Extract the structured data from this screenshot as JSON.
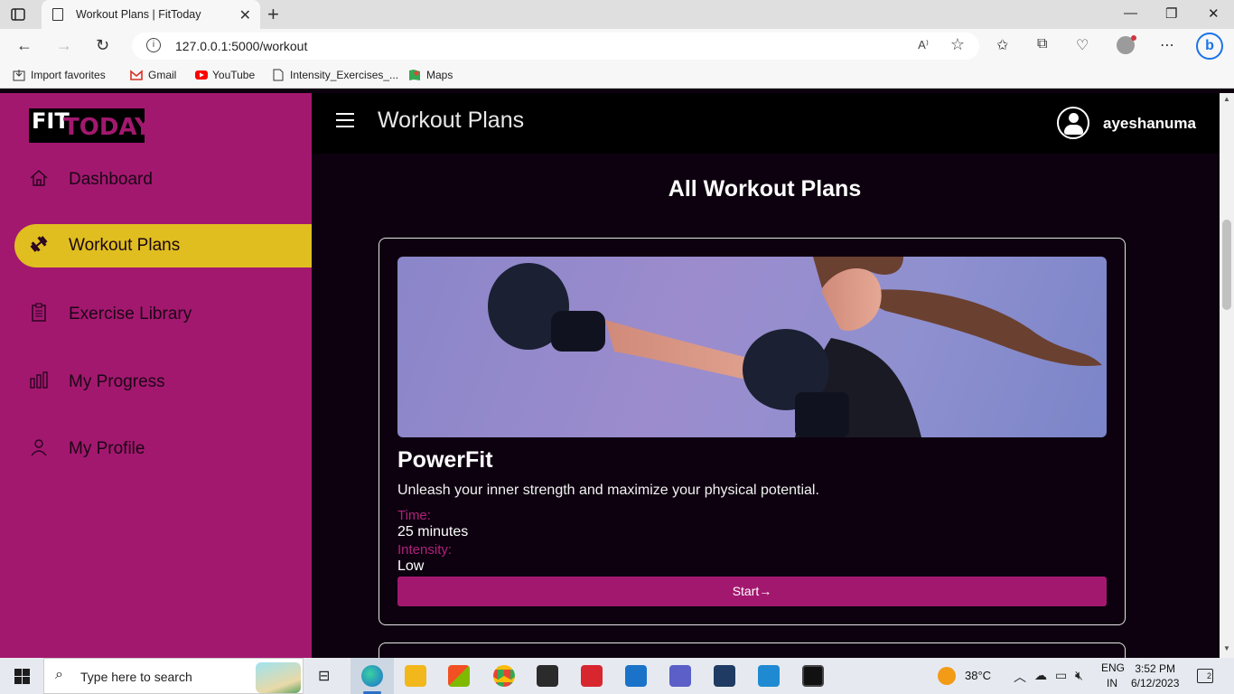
{
  "browser": {
    "tab_title": "Workout Plans | FitToday",
    "url": "127.0.0.1:5000/workout",
    "read_aloud": "A⁾",
    "favorites": [
      {
        "label": "Import favorites",
        "icon": "import-icon"
      },
      {
        "label": "Gmail",
        "icon": "gmail-icon"
      },
      {
        "label": "YouTube",
        "icon": "youtube-icon"
      },
      {
        "label": "Intensity_Exercises_...",
        "icon": "page-icon"
      },
      {
        "label": "Maps",
        "icon": "maps-icon"
      }
    ]
  },
  "sidebar": {
    "logo_fit": "FIT",
    "logo_today": "TODAY",
    "items": [
      {
        "label": "Dashboard",
        "icon": "home-icon",
        "active": false
      },
      {
        "label": "Workout Plans",
        "icon": "dumbbell-icon",
        "active": true
      },
      {
        "label": "Exercise Library",
        "icon": "clipboard-icon",
        "active": false
      },
      {
        "label": "My Progress",
        "icon": "bar-chart-icon",
        "active": false
      },
      {
        "label": "My Profile",
        "icon": "user-icon",
        "active": false
      }
    ]
  },
  "header": {
    "title": "Workout Plans",
    "username": "ayeshanuma"
  },
  "main": {
    "section_title": "All Workout Plans",
    "plans": [
      {
        "title": "PowerFit",
        "description": "Unleash your inner strength and maximize your physical potential.",
        "time_label": "Time:",
        "time_value": "25 minutes",
        "intensity_label": "Intensity:",
        "intensity_value": "Low",
        "button_label": "Start→"
      }
    ]
  },
  "taskbar": {
    "search_placeholder": "Type here to search",
    "temperature": "38°C",
    "language_top": "ENG",
    "language_bottom": "IN",
    "time": "3:52 PM",
    "date": "6/12/2023",
    "notifications": "2"
  },
  "colors": {
    "sidebar": "#a3186f",
    "active_item": "#e0be1f",
    "accent": "#a3186f",
    "page_bg": "#0d000f"
  }
}
